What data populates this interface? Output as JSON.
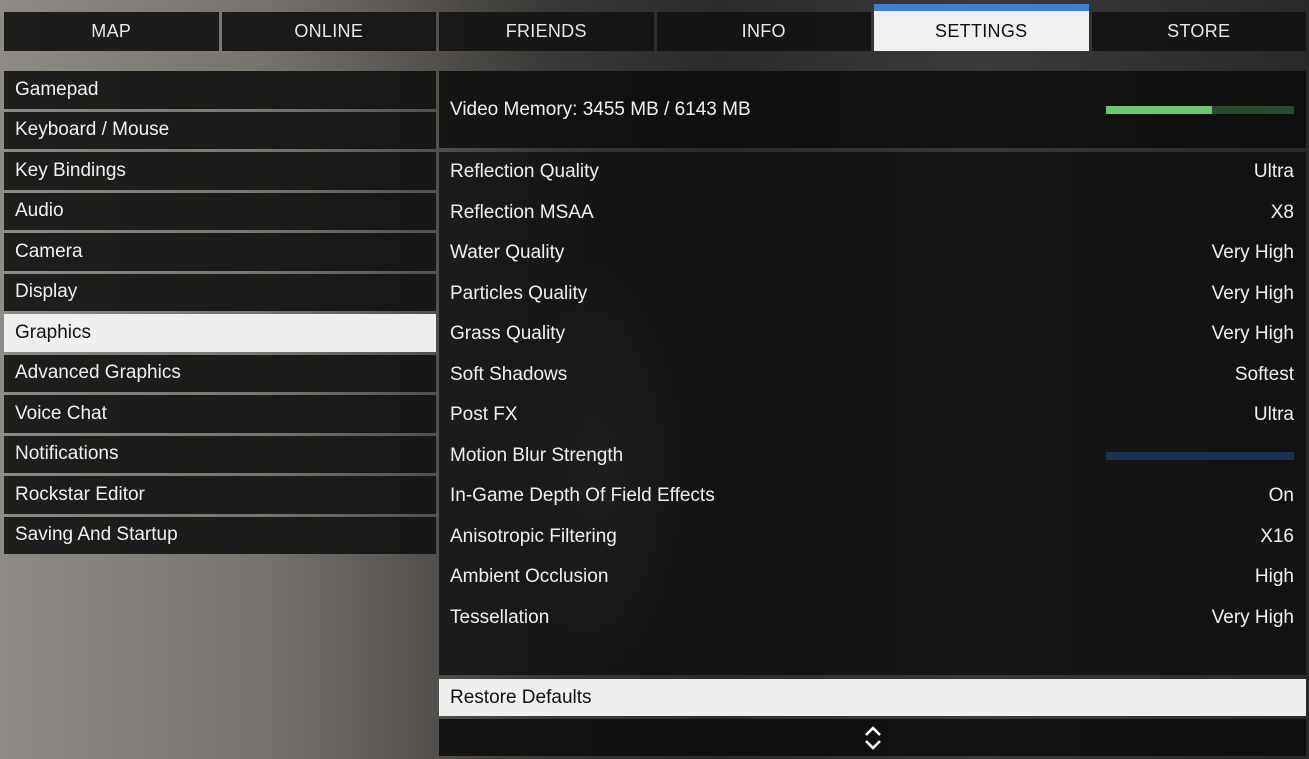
{
  "tabs": [
    {
      "label": "MAP",
      "active": false
    },
    {
      "label": "ONLINE",
      "active": false
    },
    {
      "label": "FRIENDS",
      "active": false
    },
    {
      "label": "INFO",
      "active": false
    },
    {
      "label": "SETTINGS",
      "active": true
    },
    {
      "label": "STORE",
      "active": false
    }
  ],
  "sidebar": {
    "items": [
      {
        "label": "Gamepad"
      },
      {
        "label": "Keyboard / Mouse"
      },
      {
        "label": "Key Bindings"
      },
      {
        "label": "Audio"
      },
      {
        "label": "Camera"
      },
      {
        "label": "Display"
      },
      {
        "label": "Graphics",
        "active": true
      },
      {
        "label": "Advanced Graphics"
      },
      {
        "label": "Voice Chat"
      },
      {
        "label": "Notifications"
      },
      {
        "label": "Rockstar Editor"
      },
      {
        "label": "Saving And Startup"
      }
    ]
  },
  "video_memory": {
    "label": "Video Memory: 3455 MB / 6143 MB",
    "used_fraction": 0.5625
  },
  "settings": [
    {
      "name": "Reflection Quality",
      "value": "Ultra"
    },
    {
      "name": "Reflection MSAA",
      "value": "X8"
    },
    {
      "name": "Water Quality",
      "value": "Very High"
    },
    {
      "name": "Particles Quality",
      "value": "Very High"
    },
    {
      "name": "Grass Quality",
      "value": "Very High"
    },
    {
      "name": "Soft Shadows",
      "value": "Softest"
    },
    {
      "name": "Post FX",
      "value": "Ultra"
    },
    {
      "name": "Motion Blur Strength",
      "slider": 0.0
    },
    {
      "name": "In-Game Depth Of Field Effects",
      "value": "On"
    },
    {
      "name": "Anisotropic Filtering",
      "value": "X16"
    },
    {
      "name": "Ambient Occlusion",
      "value": "High"
    },
    {
      "name": "Tessellation",
      "value": "Very High"
    }
  ],
  "restore": {
    "label": "Restore Defaults"
  },
  "scroll_icon": "up-down-chevron-icon",
  "colors": {
    "accent": "#3d7fd1",
    "vram_fill": "#6ec86f",
    "vram_track": "#2b4a2e",
    "slider_track": "#1c3150"
  }
}
